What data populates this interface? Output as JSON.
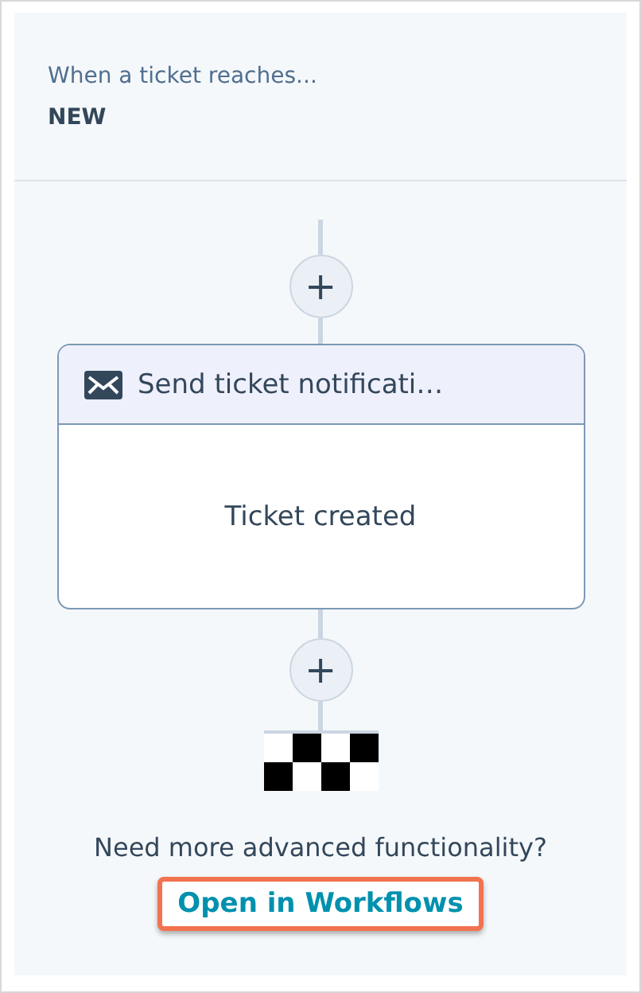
{
  "trigger": {
    "label": "When a ticket reaches...",
    "stage": "NEW"
  },
  "action": {
    "title": "Send ticket notificati…",
    "body": "Ticket created"
  },
  "add_buttons": [
    {
      "symbol": "+"
    },
    {
      "symbol": "+"
    }
  ],
  "footer": {
    "prompt": "Need more advanced functionality?",
    "link": "Open in Workflows",
    "highlighted": true
  }
}
